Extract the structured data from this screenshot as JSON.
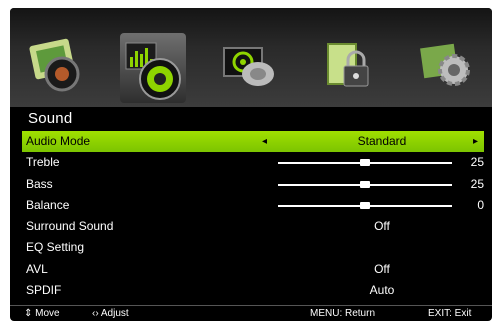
{
  "menu_icons": [
    {
      "name": "picture-icon",
      "selected": false
    },
    {
      "name": "sound-icon",
      "selected": true
    },
    {
      "name": "channel-icon",
      "selected": false
    },
    {
      "name": "lock-icon",
      "selected": false
    },
    {
      "name": "setup-icon",
      "selected": false
    }
  ],
  "section_title": "Sound",
  "colors": {
    "highlight": "#8fd400",
    "background": "#000000"
  },
  "rows": {
    "audio_mode": {
      "label": "Audio Mode",
      "value": "Standard",
      "arrow_left": "◂",
      "arrow_right": "▸"
    },
    "treble": {
      "label": "Treble",
      "value": "25",
      "level": 0.5
    },
    "bass": {
      "label": "Bass",
      "value": "25",
      "level": 0.5
    },
    "balance": {
      "label": "Balance",
      "value": "0",
      "level": 0.5
    },
    "surround": {
      "label": "Surround Sound",
      "value": "Off"
    },
    "eq": {
      "label": "EQ Setting"
    },
    "avl": {
      "label": "AVL",
      "value": "Off"
    },
    "spdif": {
      "label": "SPDIF",
      "value": "Auto"
    }
  },
  "footer": {
    "move": "⇕ Move",
    "adjust": "‹› Adjust",
    "menu": "MENU: Return",
    "exit": "EXIT: Exit"
  }
}
